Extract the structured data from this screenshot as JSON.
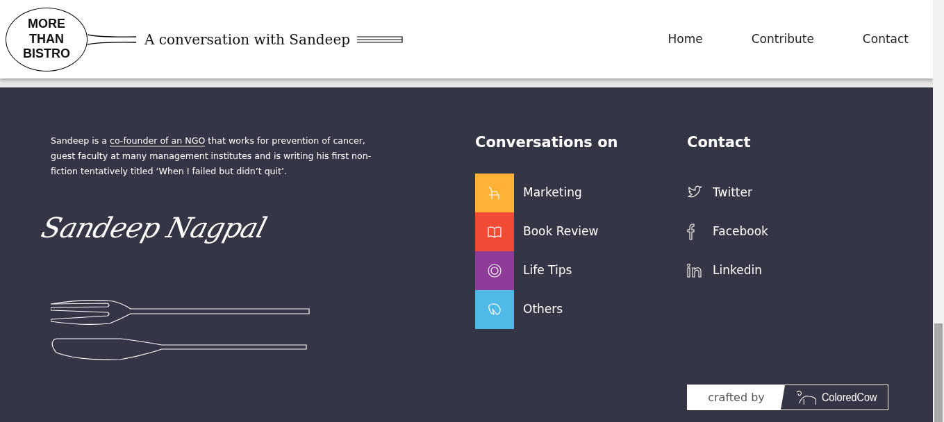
{
  "header": {
    "logo_lines": [
      "MORE",
      "THAN",
      "BISTRO"
    ],
    "tagline": "A conversation with Sandeep",
    "nav": [
      {
        "label": "Home"
      },
      {
        "label": "Contribute"
      },
      {
        "label": "Contact"
      }
    ]
  },
  "about": {
    "text_before": "Sandeep is a ",
    "link": "co-founder of an NGO",
    "text_after": " that works for prevention of cancer, guest faculty at many management institutes and is writing his first non-fiction tentatively titled ‘When I failed but didn’t quit’.",
    "signature": "Sandeep Nagpal"
  },
  "conversations": {
    "title": "Conversations on",
    "items": [
      {
        "label": "Marketing",
        "color": "#fdb235"
      },
      {
        "label": "Book Review",
        "color": "#f14b35"
      },
      {
        "label": "Life Tips",
        "color": "#8f3c99"
      },
      {
        "label": "Others",
        "color": "#4fbae6"
      }
    ]
  },
  "contact": {
    "title": "Contact",
    "items": [
      {
        "label": "Twitter"
      },
      {
        "label": "Facebook"
      },
      {
        "label": "Linkedin"
      }
    ]
  },
  "credit": {
    "prefix": "crafted by",
    "brand": "ColoredCow"
  }
}
